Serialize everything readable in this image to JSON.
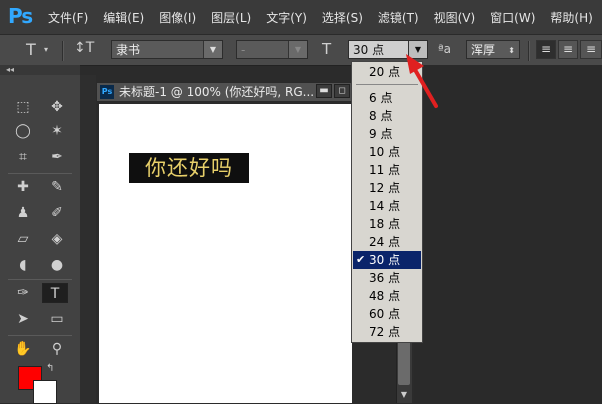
{
  "app": {
    "logo": "Ps"
  },
  "menu": [
    "文件(F)",
    "编辑(E)",
    "图像(I)",
    "图层(L)",
    "文字(Y)",
    "选择(S)",
    "滤镜(T)",
    "视图(V)",
    "窗口(W)",
    "帮助(H)"
  ],
  "options": {
    "tool_glyph": "T",
    "orient_glyph": "↕T",
    "font_family": "隶书",
    "font_style": "-",
    "size_glyph": "T",
    "font_size": "30 点",
    "aa_glyph": "ªa",
    "aa_method": "浑厚",
    "align_left": "≡",
    "align_center": "≡"
  },
  "document": {
    "title": "未标题-1 @ 100% (你还好吗, RG...",
    "ps_icon": "Ps",
    "min_label": "▬",
    "max_label": "◻",
    "canvas_text": "你还好吗"
  },
  "tools_collapse": "◂◂",
  "size_dropdown": {
    "current_top": "20 点",
    "items": [
      {
        "label": "6 点",
        "selected": false
      },
      {
        "label": "8 点",
        "selected": false
      },
      {
        "label": "9 点",
        "selected": false
      },
      {
        "label": "10 点",
        "selected": false
      },
      {
        "label": "11 点",
        "selected": false
      },
      {
        "label": "12 点",
        "selected": false
      },
      {
        "label": "14 点",
        "selected": false
      },
      {
        "label": "18 点",
        "selected": false
      },
      {
        "label": "24 点",
        "selected": false
      },
      {
        "label": "30 点",
        "selected": true
      },
      {
        "label": "36 点",
        "selected": false
      },
      {
        "label": "48 点",
        "selected": false
      },
      {
        "label": "60 点",
        "selected": false
      },
      {
        "label": "72 点",
        "selected": false
      }
    ],
    "check_mark": "✔"
  },
  "colors": {
    "foreground": "#ff0000",
    "background": "#ffffff",
    "selection": "#0a246a",
    "annotation": "#e02020"
  }
}
